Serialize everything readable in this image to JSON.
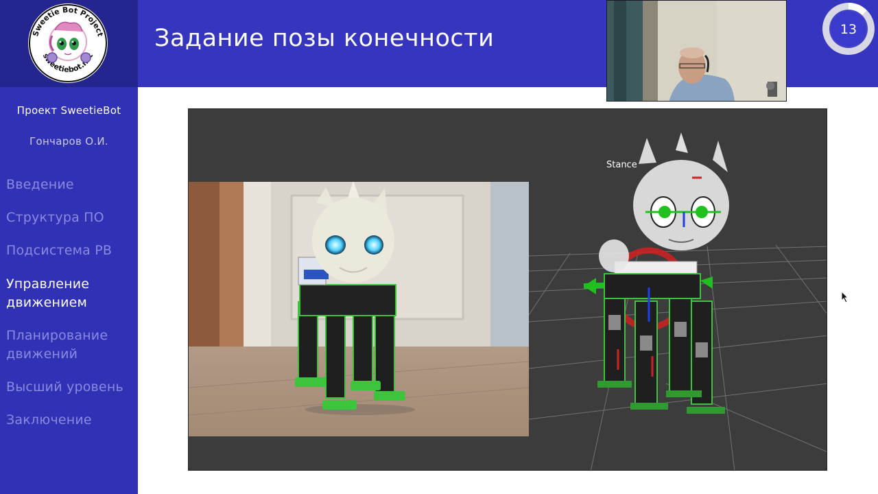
{
  "sidebar": {
    "logo_text_top": "Sweetie Bot Project",
    "logo_text_bottom": "sweetiebot.net",
    "project": "Проект SweetieBot",
    "author": "Гончаров О.И.",
    "nav": [
      {
        "label": "Введение",
        "active": false
      },
      {
        "label": "Структура ПО",
        "active": false
      },
      {
        "label": "Подсистема РВ",
        "active": false
      },
      {
        "label": "Управление движением",
        "active": true
      },
      {
        "label": "Планирование движений",
        "active": false
      },
      {
        "label": "Высший уровень",
        "active": false
      },
      {
        "label": "Заключение",
        "active": false
      }
    ]
  },
  "header": {
    "title": "Задание позы конечности",
    "page_number": "13"
  },
  "main": {
    "viz_label": "Stance"
  },
  "colors": {
    "sidebar": "#3131b5",
    "header": "#3535c0",
    "logo_box": "#25258f",
    "robot_green": "#3cc43c"
  }
}
